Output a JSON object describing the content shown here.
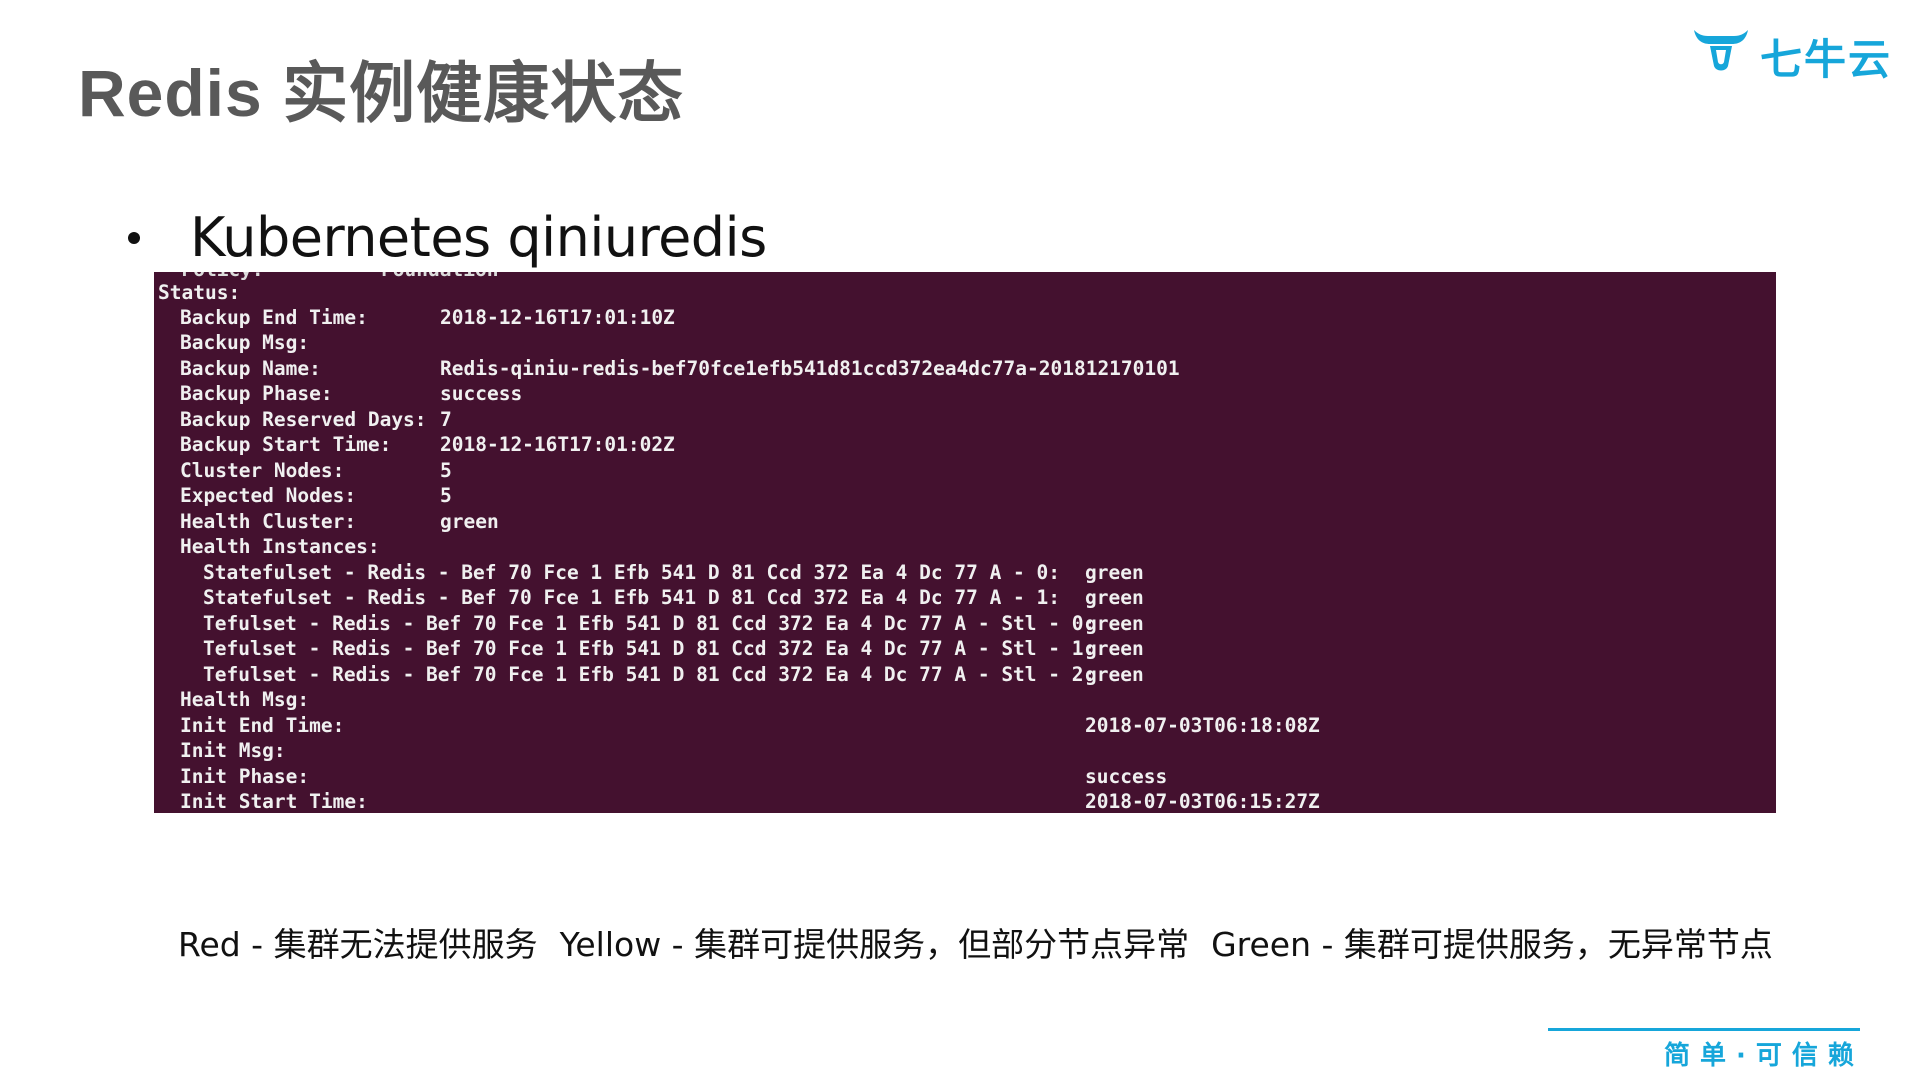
{
  "slide": {
    "title": "Redis 实例健康状态",
    "logo_text": "七牛云",
    "bullet": "Kubernetes qiniuredis",
    "slogan": "简单·可信赖",
    "accent_color": "#16a6da"
  },
  "terminal": {
    "background": "#44112f",
    "cut_line": "  Policy:          Foundation",
    "status_label": "Status:",
    "rows": [
      {
        "key": "Backup End Time:",
        "value": "2018-12-16T17:01:10Z"
      },
      {
        "key": "Backup Msg:",
        "value": ""
      },
      {
        "key": "Backup Name:",
        "value": "Redis-qiniu-redis-bef70fce1efb541d81ccd372ea4dc77a-201812170101"
      },
      {
        "key": "Backup Phase:",
        "value": "success"
      },
      {
        "key": "Backup Reserved Days:",
        "value": "7"
      },
      {
        "key": "Backup Start Time:",
        "value": "2018-12-16T17:01:02Z"
      },
      {
        "key": "Cluster Nodes:",
        "value": "5"
      },
      {
        "key": "Expected Nodes:",
        "value": "5"
      },
      {
        "key": "Health Cluster:",
        "value": "green"
      },
      {
        "key": "Health Instances:",
        "value": ""
      }
    ],
    "instances": [
      {
        "key": "Statefulset - Redis - Bef 70 Fce 1 Efb 541 D 81 Ccd 372 Ea 4 Dc 77 A - 0:",
        "value": "green"
      },
      {
        "key": "Statefulset - Redis - Bef 70 Fce 1 Efb 541 D 81 Ccd 372 Ea 4 Dc 77 A - 1:",
        "value": "green"
      },
      {
        "key": "Tefulset - Redis - Bef 70 Fce 1 Efb 541 D 81 Ccd 372 Ea 4 Dc 77 A - Stl - 0:",
        "value": "green"
      },
      {
        "key": "Tefulset - Redis - Bef 70 Fce 1 Efb 541 D 81 Ccd 372 Ea 4 Dc 77 A - Stl - 1:",
        "value": "green"
      },
      {
        "key": "Tefulset - Redis - Bef 70 Fce 1 Efb 541 D 81 Ccd 372 Ea 4 Dc 77 A - Stl - 2:",
        "value": "green"
      }
    ],
    "tail_rows": [
      {
        "key": "Health Msg:",
        "value": ""
      },
      {
        "key": "Init End Time:",
        "value": "2018-07-03T06:18:08Z"
      },
      {
        "key": "Init Msg:",
        "value": ""
      },
      {
        "key": "Init Phase:",
        "value": "success"
      },
      {
        "key": "Init Start Time:",
        "value": "2018-07-03T06:15:27Z"
      }
    ]
  },
  "legend": {
    "red": "Red - 集群无法提供服务",
    "yellow": "Yellow - 集群可提供服务，但部分节点异常",
    "green": "Green - 集群可提供服务，无异常节点"
  }
}
